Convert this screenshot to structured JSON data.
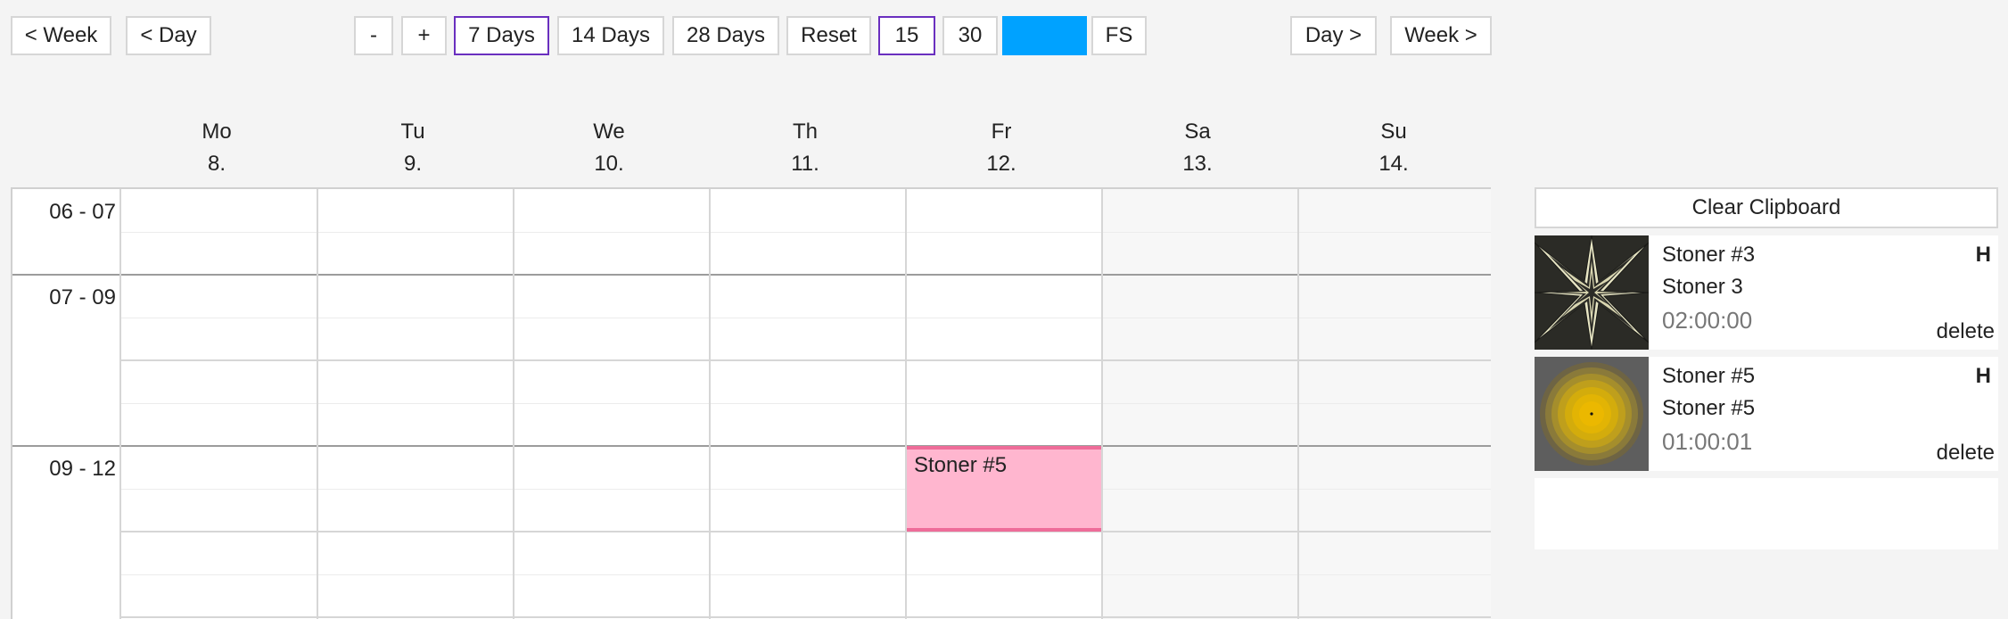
{
  "nav": {
    "prev_week": "< Week",
    "prev_day": "< Day",
    "zoom_out": "-",
    "zoom_in": "+",
    "days_7": "7 Days",
    "days_14": "14 Days",
    "days_28": "28 Days",
    "reset": "Reset",
    "interval_15": "15",
    "interval_30": "30",
    "color_button": "",
    "fullscreen": "FS",
    "next_day": "Day >",
    "next_week": "Week >"
  },
  "days": [
    {
      "name": "Mo",
      "date": "8."
    },
    {
      "name": "Tu",
      "date": "9."
    },
    {
      "name": "We",
      "date": "10."
    },
    {
      "name": "Th",
      "date": "11."
    },
    {
      "name": "Fr",
      "date": "12."
    },
    {
      "name": "Sa",
      "date": "13."
    },
    {
      "name": "Su",
      "date": "14."
    }
  ],
  "time_slots": [
    "06 - 07",
    "07 - 09",
    "09 - 12"
  ],
  "events": [
    {
      "day": "Fr",
      "slot": "09 - 12",
      "title": "Stoner #5"
    }
  ],
  "clipboard": {
    "clear_label": "Clear Clipboard",
    "items": [
      {
        "title": "Stoner #3",
        "subtitle": "Stoner 3",
        "duration": "02:00:00",
        "flag": "H",
        "delete_label": "delete",
        "thumb_icon": "starburst-pattern-icon"
      },
      {
        "title": "Stoner #5",
        "subtitle": "Stoner #5",
        "duration": "01:00:01",
        "flag": "H",
        "delete_label": "delete",
        "thumb_icon": "concentric-circles-icon"
      }
    ]
  },
  "colors": {
    "accent_border": "#6a2fbf",
    "color_button": "#00a2ff",
    "event_fill": "#ffb6cf",
    "event_border": "#ee6c99"
  }
}
